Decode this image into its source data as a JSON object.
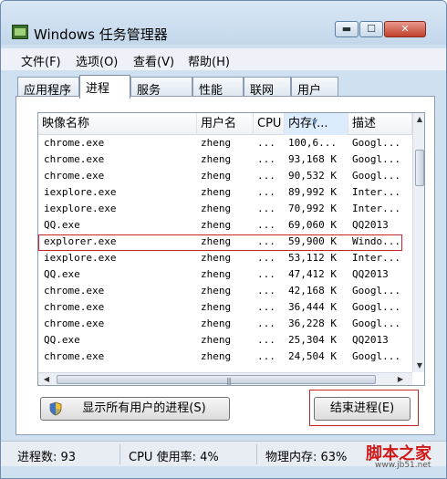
{
  "window": {
    "title": "Windows 任务管理器"
  },
  "titlebar": {
    "min": "▬",
    "max": "☐",
    "close": "✕"
  },
  "menu": [
    "文件(F)",
    "选项(O)",
    "查看(V)",
    "帮助(H)"
  ],
  "tabs": [
    "应用程序",
    "进程",
    "服务",
    "性能",
    "联网",
    "用户"
  ],
  "active_tab": "进程",
  "columns": [
    "映像名称",
    "用户名",
    "CPU",
    "内存(...",
    "描述"
  ],
  "rows": [
    {
      "name": "chrome.exe",
      "user": "zheng",
      "cpu": "...",
      "mem": "100,6...",
      "desc": "Googl..."
    },
    {
      "name": "chrome.exe",
      "user": "zheng",
      "cpu": "...",
      "mem": "93,168 K",
      "desc": "Googl..."
    },
    {
      "name": "chrome.exe",
      "user": "zheng",
      "cpu": "...",
      "mem": "90,532 K",
      "desc": "Googl..."
    },
    {
      "name": "iexplore.exe",
      "user": "zheng",
      "cpu": "...",
      "mem": "89,992 K",
      "desc": "Inter..."
    },
    {
      "name": "iexplore.exe",
      "user": "zheng",
      "cpu": "...",
      "mem": "70,992 K",
      "desc": "Inter..."
    },
    {
      "name": "QQ.exe",
      "user": "zheng",
      "cpu": "...",
      "mem": "69,060 K",
      "desc": "QQ2013"
    },
    {
      "name": "explorer.exe",
      "user": "zheng",
      "cpu": "...",
      "mem": "59,900 K",
      "desc": "Windo..."
    },
    {
      "name": "iexplore.exe",
      "user": "zheng",
      "cpu": "...",
      "mem": "53,112 K",
      "desc": "Inter..."
    },
    {
      "name": "QQ.exe",
      "user": "zheng",
      "cpu": "...",
      "mem": "47,412 K",
      "desc": "QQ2013"
    },
    {
      "name": "chrome.exe",
      "user": "zheng",
      "cpu": "...",
      "mem": "42,168 K",
      "desc": "Googl..."
    },
    {
      "name": "chrome.exe",
      "user": "zheng",
      "cpu": "...",
      "mem": "36,444 K",
      "desc": "Googl..."
    },
    {
      "name": "chrome.exe",
      "user": "zheng",
      "cpu": "...",
      "mem": "36,228 K",
      "desc": "Googl..."
    },
    {
      "name": "QQ.exe",
      "user": "zheng",
      "cpu": "...",
      "mem": "25,304 K",
      "desc": "QQ2013"
    },
    {
      "name": "chrome.exe",
      "user": "zheng",
      "cpu": "...",
      "mem": "24,504 K",
      "desc": "Googl..."
    }
  ],
  "buttons": {
    "show_all": "显示所有用户的进程(S)",
    "end_process": "结束进程(E)"
  },
  "status": {
    "processes": "进程数: 93",
    "cpu": "CPU 使用率: 4%",
    "memory": "物理内存: 63%"
  },
  "watermark": {
    "text": "脚本之家",
    "url": "www.jb51.net"
  },
  "colors": {
    "highlight": "#c8242c",
    "titlebar": "#c3d7ec",
    "sorted_header": "#dcecfc"
  }
}
